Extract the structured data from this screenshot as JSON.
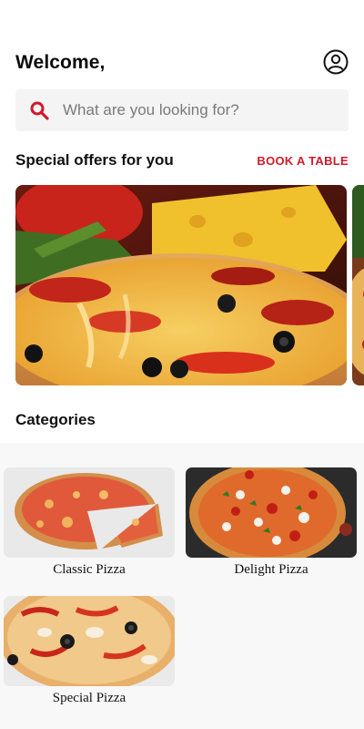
{
  "header": {
    "welcome": "Welcome,"
  },
  "search": {
    "placeholder": "What are you looking for?",
    "value": ""
  },
  "offers": {
    "title": "Special offers for you",
    "book_label": "BOOK A TABLE"
  },
  "categories": {
    "title": "Categories",
    "items": [
      {
        "label": "Classic Pizza"
      },
      {
        "label": "Delight Pizza"
      },
      {
        "label": "Special Pizza"
      }
    ]
  },
  "colors": {
    "accent": "#d11a2a",
    "search_bg": "#f4f4f4",
    "grid_bg": "#f8f8f8"
  },
  "icons": {
    "profile": "user-circle-icon",
    "search": "search-icon"
  }
}
